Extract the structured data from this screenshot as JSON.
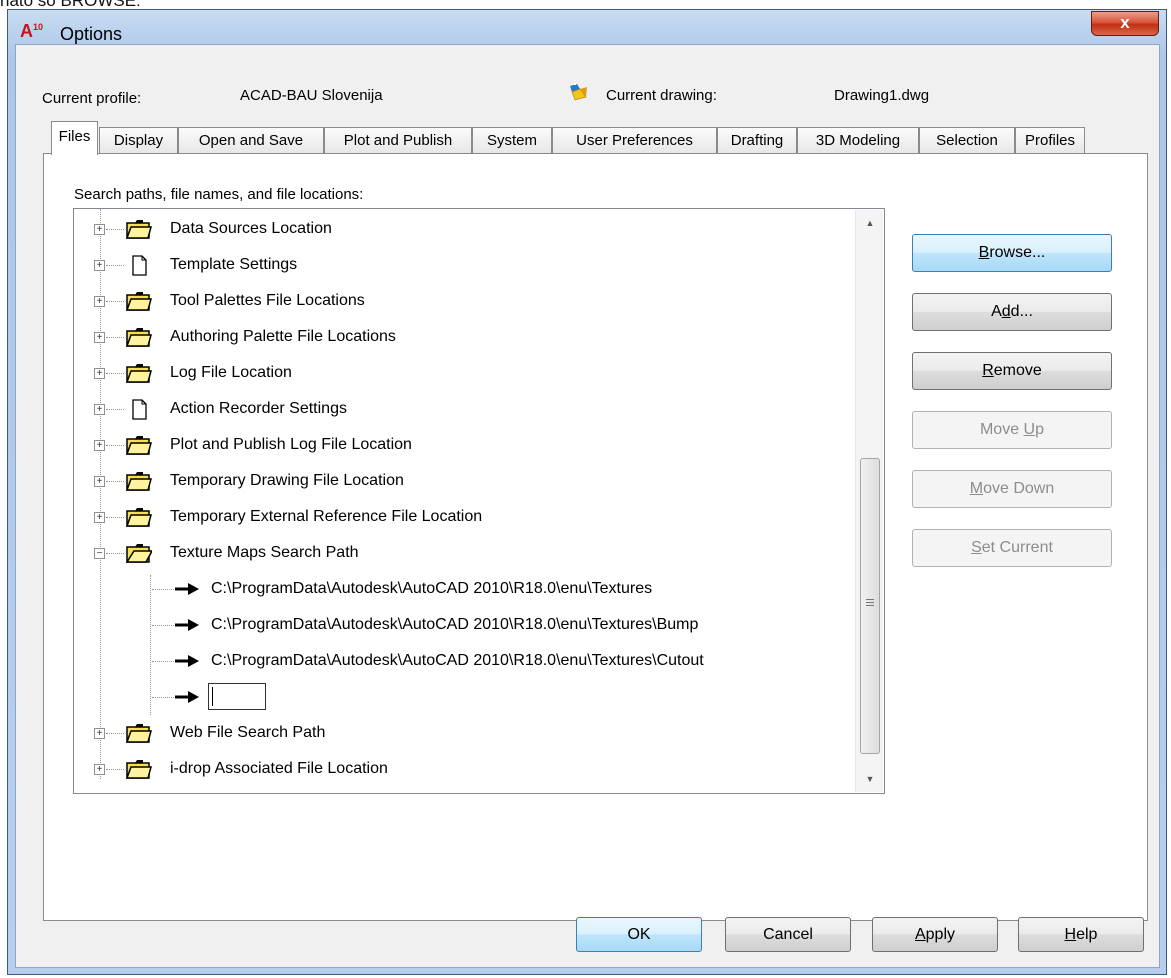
{
  "page_caption": "nato so BROWSE:",
  "window": {
    "title": "Options",
    "close_symbol": "x",
    "app_badge": "A",
    "app_badge_version": "10"
  },
  "header": {
    "profile_label": "Current profile:",
    "profile_value": "ACAD-BAU Slovenija",
    "drawing_label": "Current drawing:",
    "drawing_value": "Drawing1.dwg"
  },
  "tabs": [
    {
      "label": "Files",
      "active": true
    },
    {
      "label": "Display"
    },
    {
      "label": "Open and Save"
    },
    {
      "label": "Plot and Publish"
    },
    {
      "label": "System"
    },
    {
      "label": "User Preferences"
    },
    {
      "label": "Drafting"
    },
    {
      "label": "3D Modeling"
    },
    {
      "label": "Selection"
    },
    {
      "label": "Profiles"
    }
  ],
  "files_tab": {
    "section_label": "Search paths, file names, and file locations:",
    "tree": [
      {
        "label": "Data Sources Location",
        "icon": "folder-icon",
        "expander": "+"
      },
      {
        "label": "Template Settings",
        "icon": "document-icon",
        "expander": "+"
      },
      {
        "label": "Tool Palettes File Locations",
        "icon": "folder-icon",
        "expander": "+"
      },
      {
        "label": "Authoring Palette File Locations",
        "icon": "folder-icon",
        "expander": "+"
      },
      {
        "label": "Log File Location",
        "icon": "folder-icon",
        "expander": "+"
      },
      {
        "label": "Action Recorder Settings",
        "icon": "document-icon",
        "expander": "+"
      },
      {
        "label": "Plot and Publish Log File Location",
        "icon": "folder-icon",
        "expander": "+"
      },
      {
        "label": "Temporary Drawing File Location",
        "icon": "folder-icon",
        "expander": "+"
      },
      {
        "label": "Temporary External Reference File Location",
        "icon": "folder-icon",
        "expander": "+"
      },
      {
        "label": "Texture Maps Search Path",
        "icon": "open-folder-icon",
        "expander": "−",
        "children": [
          "C:\\ProgramData\\Autodesk\\AutoCAD 2010\\R18.0\\enu\\Textures",
          "C:\\ProgramData\\Autodesk\\AutoCAD 2010\\R18.0\\enu\\Textures\\Bump",
          "C:\\ProgramData\\Autodesk\\AutoCAD 2010\\R18.0\\enu\\Textures\\Cutout",
          ""
        ]
      },
      {
        "label": "Web File Search Path",
        "icon": "folder-icon",
        "expander": "+"
      },
      {
        "label": "i-drop Associated File Location",
        "icon": "folder-icon",
        "expander": "+"
      }
    ],
    "buttons": {
      "browse": {
        "pre": "",
        "key": "B",
        "post": "rowse..."
      },
      "add": {
        "pre": "A",
        "key": "d",
        "post": "d..."
      },
      "remove": {
        "pre": "",
        "key": "R",
        "post": "emove"
      },
      "move_up": {
        "pre": "Move ",
        "key": "U",
        "post": "p"
      },
      "move_down": {
        "pre": "",
        "key": "M",
        "post": "ove Down"
      },
      "set_current": {
        "pre": "",
        "key": "S",
        "post": "et Current"
      }
    }
  },
  "footer": {
    "ok": "OK",
    "cancel": "Cancel",
    "apply": {
      "pre": "",
      "key": "A",
      "post": "pply"
    },
    "help": {
      "pre": "",
      "key": "H",
      "post": "elp"
    }
  },
  "colors": {
    "title_gradient": "#bcd3ee",
    "close_button": "#c22f13",
    "focus_button": "#bee6fd",
    "folder_yellow": "#f7e04a"
  }
}
